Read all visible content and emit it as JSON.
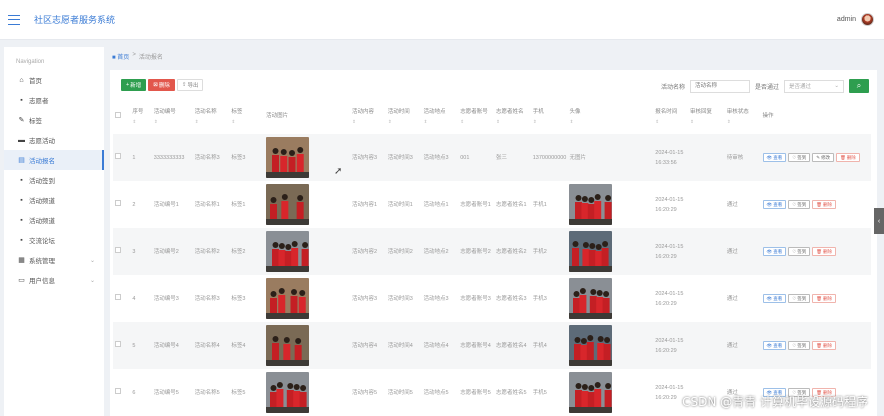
{
  "header": {
    "title": "社区志愿者服务系统",
    "user_name": "admin"
  },
  "sidebar": {
    "heading": "Navigation",
    "items": [
      {
        "label": "首页",
        "icon": "home-icon",
        "glyph": "⌂"
      },
      {
        "label": "志愿者",
        "icon": "grid-icon",
        "glyph": "▪"
      },
      {
        "label": "标签",
        "icon": "tag-icon",
        "glyph": "✎"
      },
      {
        "label": "志愿活动",
        "icon": "briefcase-icon",
        "glyph": "▬"
      },
      {
        "label": "活动报名",
        "icon": "clipboard-icon",
        "glyph": "▤"
      },
      {
        "label": "活动签到",
        "icon": "grid-icon",
        "glyph": "▪"
      },
      {
        "label": "活动频道",
        "icon": "grid-icon",
        "glyph": "▪"
      },
      {
        "label": "活动频道",
        "icon": "grid-icon",
        "glyph": "▪"
      },
      {
        "label": "交流论坛",
        "icon": "grid-icon",
        "glyph": "▪"
      },
      {
        "label": "系统管理",
        "icon": "table-icon",
        "glyph": "▦"
      },
      {
        "label": "用户信息",
        "icon": "window-icon",
        "glyph": "▭"
      }
    ]
  },
  "breadcrumb": {
    "home": "首页",
    "separator": ">",
    "current": "活动报名"
  },
  "toolbar": {
    "add": "新增",
    "delete": "删除",
    "export": "导出"
  },
  "filters": {
    "name_label": "活动名称",
    "name_placeholder": "活动名称",
    "audit_label": "是否通过",
    "audit_placeholder": "是否通过"
  },
  "table": {
    "columns": [
      "序号",
      "活动编号",
      "活动名称",
      "标签",
      "活动图片",
      "活动内容",
      "活动时间",
      "活动地点",
      "志愿者账号",
      "志愿者姓名",
      "手机",
      "头像",
      "报名时间",
      "审核回复",
      "审核状态",
      "操作"
    ],
    "rows": [
      {
        "index": "1",
        "code": "3333333333",
        "name": "活动名称3",
        "tag": "标签3",
        "content": "活动内容3",
        "time": "活动时间3",
        "place": "活动地点3",
        "account": "001",
        "vname": "张三",
        "phone": "13700000000",
        "avatar_text": "无图片",
        "signup": "2024-01-15 16:33:56",
        "reply": "",
        "status": "待审核",
        "ops": [
          "查看",
          "签到",
          "修改",
          "删除"
        ]
      },
      {
        "index": "2",
        "code": "活动编号1",
        "name": "活动名称1",
        "tag": "标签1",
        "content": "活动内容1",
        "time": "活动时间1",
        "place": "活动地点1",
        "account": "志愿者账号1",
        "vname": "志愿者姓名1",
        "phone": "手机1",
        "avatar_text": "",
        "signup": "2024-01-15 16:20:29",
        "reply": "",
        "status": "通过",
        "ops": [
          "查看",
          "签到",
          "删除"
        ]
      },
      {
        "index": "3",
        "code": "活动编号2",
        "name": "活动名称2",
        "tag": "标签2",
        "content": "活动内容2",
        "time": "活动时间2",
        "place": "活动地点2",
        "account": "志愿者账号2",
        "vname": "志愿者姓名2",
        "phone": "手机2",
        "avatar_text": "",
        "signup": "2024-01-15 16:20:29",
        "reply": "",
        "status": "通过",
        "ops": [
          "查看",
          "签到",
          "删除"
        ]
      },
      {
        "index": "4",
        "code": "活动编号3",
        "name": "活动名称3",
        "tag": "标签3",
        "content": "活动内容3",
        "time": "活动时间3",
        "place": "活动地点3",
        "account": "志愿者账号3",
        "vname": "志愿者姓名3",
        "phone": "手机3",
        "avatar_text": "",
        "signup": "2024-01-15 16:20:29",
        "reply": "",
        "status": "通过",
        "ops": [
          "查看",
          "签到",
          "删除"
        ]
      },
      {
        "index": "5",
        "code": "活动编号4",
        "name": "活动名称4",
        "tag": "标签4",
        "content": "活动内容4",
        "time": "活动时间4",
        "place": "活动地点4",
        "account": "志愿者账号4",
        "vname": "志愿者姓名4",
        "phone": "手机4",
        "avatar_text": "",
        "signup": "2024-01-15 16:20:29",
        "reply": "",
        "status": "通过",
        "ops": [
          "查看",
          "签到",
          "删除"
        ]
      },
      {
        "index": "6",
        "code": "活动编号5",
        "name": "活动名称5",
        "tag": "标签5",
        "content": "活动内容5",
        "time": "活动时间5",
        "place": "活动地点5",
        "account": "志愿者账号5",
        "vname": "志愿者姓名5",
        "phone": "手机5",
        "avatar_text": "",
        "signup": "2024-01-15 16:20:29",
        "reply": "",
        "status": "通过",
        "ops": [
          "查看",
          "签到",
          "删除"
        ]
      }
    ]
  },
  "watermark": "CSDN @青青 计算机毕设源码程序",
  "colors": {
    "accent": "#3a7bd5",
    "success": "#2e9e4f",
    "danger": "#e2574c"
  }
}
